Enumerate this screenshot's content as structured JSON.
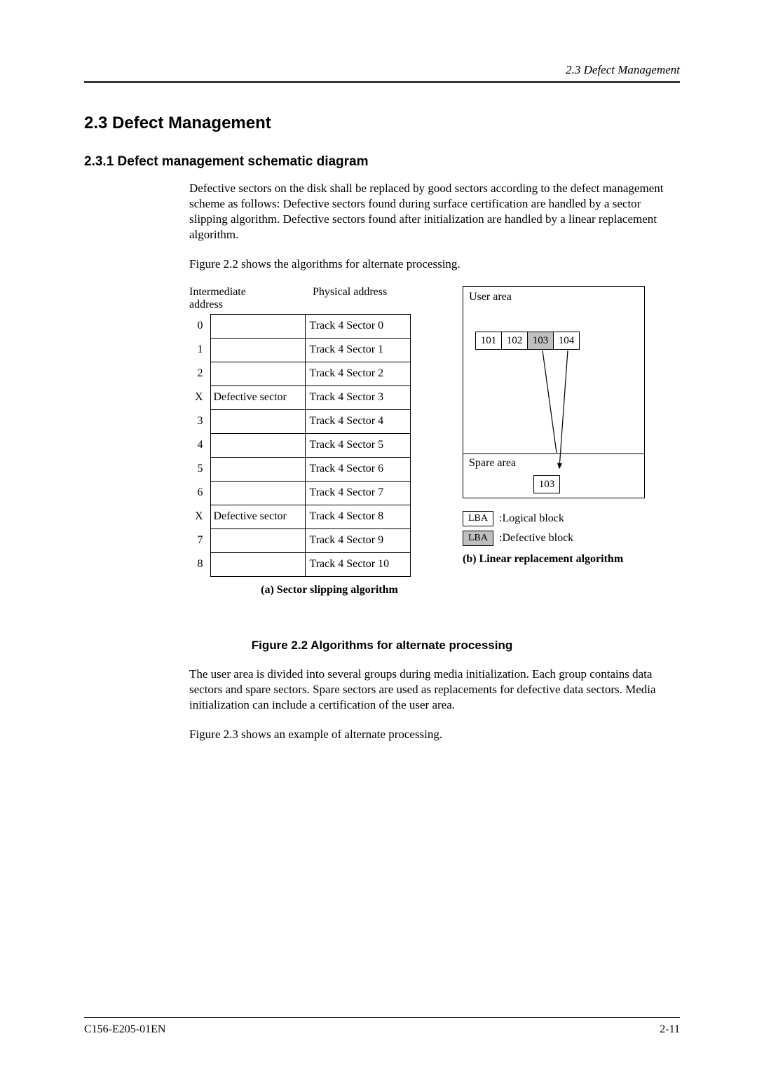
{
  "header": {
    "section_ref": "2.3  Defect Management"
  },
  "h2": "2.3  Defect Management",
  "h3": "2.3.1  Defect management schematic diagram",
  "para1": "Defective sectors on the disk shall be replaced by good sectors according to the defect management scheme as follows:  Defective sectors found during surface certification are handled by a sector slipping algorithm.  Defective sectors found after initialization are handled by a linear replacement algorithm.",
  "para2": "Figure 2.2 shows the algorithms for alternate processing.",
  "labels": {
    "intermediate": "Intermediate address",
    "physical": "Physical address",
    "user_area": "User area",
    "spare_area": "Spare area",
    "caption_a": "(a) Sector slipping algorithm",
    "caption_b": "(b) Linear replacement algorithm",
    "legend_logical": ":Logical block",
    "legend_defective": ":Defective block",
    "lba": "LBA"
  },
  "slip_rows": [
    {
      "ia": "0",
      "def": "",
      "pa": "Track 4 Sector 0"
    },
    {
      "ia": "1",
      "def": "",
      "pa": "Track 4 Sector 1"
    },
    {
      "ia": "2",
      "def": "",
      "pa": "Track 4 Sector 2"
    },
    {
      "ia": "X",
      "def": "Defective sector",
      "pa": "Track 4 Sector 3"
    },
    {
      "ia": "3",
      "def": "",
      "pa": "Track 4 Sector 4"
    },
    {
      "ia": "4",
      "def": "",
      "pa": "Track 4 Sector 5"
    },
    {
      "ia": "5",
      "def": "",
      "pa": "Track 4 Sector 6"
    },
    {
      "ia": "6",
      "def": "",
      "pa": "Track 4 Sector 7"
    },
    {
      "ia": "X",
      "def": "Defective sector",
      "pa": "Track 4 Sector 8"
    },
    {
      "ia": "7",
      "def": "",
      "pa": "Track 4 Sector 9"
    },
    {
      "ia": "8",
      "def": "",
      "pa": "Track 4 Sector 10"
    }
  ],
  "user_blocks": [
    "101",
    "102",
    "103",
    "104"
  ],
  "spare_block": "103",
  "figcaption": "Figure 2.2  Algorithms for alternate processing",
  "para3": "The user area is divided into several groups during media initialization.  Each group contains data sectors and spare sectors.  Spare sectors are used as replacements for defective data sectors.  Media initialization can include a certification of the user area.",
  "para4": "Figure 2.3 shows an example of alternate processing.",
  "footer": {
    "doc_id": "C156-E205-01EN",
    "page": "2-11"
  }
}
